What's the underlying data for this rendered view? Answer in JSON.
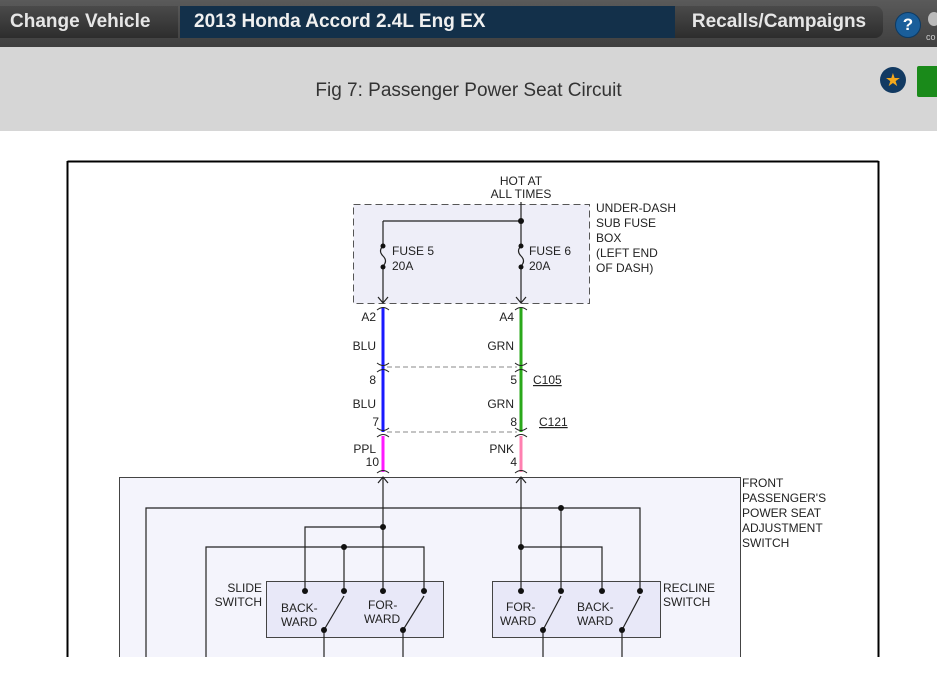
{
  "topbar": {
    "change_vehicle": "Change Vehicle",
    "vehicle": "2013 Honda Accord 2.4L Eng EX",
    "recalls": "Recalls/Campaigns",
    "help_glyph": "?",
    "partial_label": "co"
  },
  "figure": {
    "title": "Fig 7: Passenger Power Seat Circuit"
  },
  "diagram": {
    "hot1": "HOT AT",
    "hot2": "ALL TIMES",
    "fusebox": [
      "UNDER-DASH",
      "SUB FUSE",
      "BOX",
      "(LEFT END",
      "OF DASH)"
    ],
    "fuse5": "FUSE 5",
    "fuse5_rating": "20A",
    "fuse6": "FUSE 6",
    "fuse6_rating": "20A",
    "left": {
      "pin1": "A2",
      "color1": "BLU",
      "pin2": "8",
      "color2": "BLU",
      "pin3": "7",
      "color3": "PPL",
      "pin4": "10"
    },
    "right": {
      "pin1": "A4",
      "color1": "GRN",
      "pin2": "5",
      "color2": "GRN",
      "pin3": "8",
      "color3": "PNK",
      "pin4": "4"
    },
    "c105": "C105",
    "c121": "C121",
    "switch": [
      "FRONT",
      "PASSENGER'S",
      "POWER SEAT",
      "ADJUSTMENT",
      "SWITCH"
    ],
    "slide1": "SLIDE",
    "slide2": "SWITCH",
    "recline1": "RECLINE",
    "recline2": "SWITCH",
    "back1": "BACK-",
    "back2": "WARD",
    "for1": "FOR-",
    "for2": "WARD",
    "wire_colors": {
      "BLU": "#1a1aff",
      "GRN": "#2aa81a",
      "PPL": "#ff1aff",
      "PNK": "#ff80b0"
    }
  }
}
